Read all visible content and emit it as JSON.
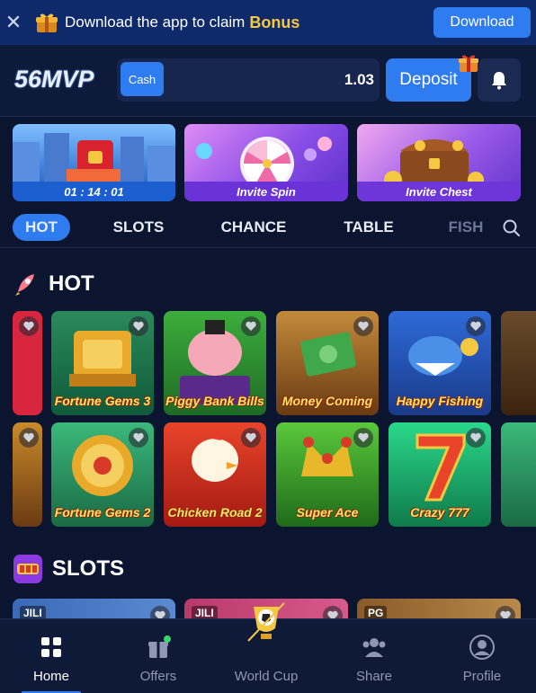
{
  "banner": {
    "text": "Download the app to claim",
    "bonus": "Bonus",
    "download_label": "Download"
  },
  "header": {
    "logo": "56MVP",
    "cash_label": "Cash",
    "balance": "1.03",
    "deposit_label": "Deposit"
  },
  "promos": [
    {
      "label": "01 : 14 : 01"
    },
    {
      "label": "Invite Spin"
    },
    {
      "label": "Invite Chest"
    }
  ],
  "tabs": [
    "HOT",
    "SLOTS",
    "CHANCE",
    "TABLE",
    "FISH"
  ],
  "hot": {
    "title": "HOT",
    "games_row1": [
      "Fortune Gems 3",
      "Piggy Bank Bills",
      "Money Coming",
      "Happy Fishing"
    ],
    "games_row2": [
      "Fortune Gems 2",
      "Chicken Road 2",
      "Super Ace",
      "Crazy 777"
    ]
  },
  "slots": {
    "title": "SLOTS",
    "providers": [
      "JILI",
      "JILI",
      "PG"
    ]
  },
  "nav": [
    "Home",
    "Offers",
    "World Cup",
    "Share",
    "Profile"
  ],
  "colors": {
    "accent": "#2f7bf0",
    "background": "#0b1530",
    "bonus": "#f5c842"
  }
}
